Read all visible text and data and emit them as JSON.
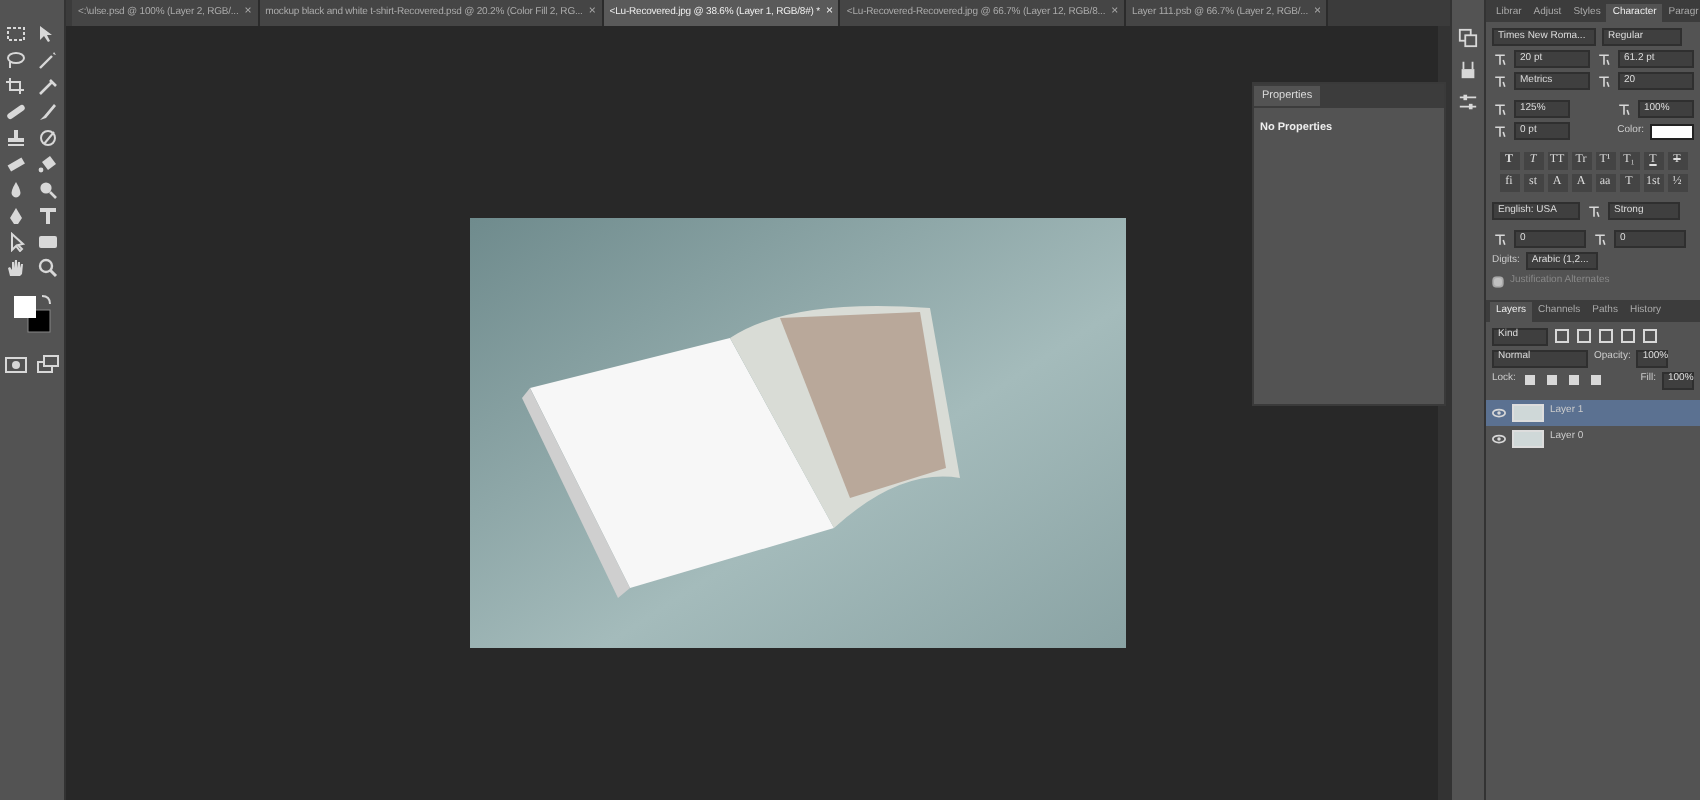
{
  "tabs": [
    {
      "label": "<:\\ulse.psd @ 100% (Layer 2, RGB/...",
      "close": "×",
      "selected": false
    },
    {
      "label": "mockup black and white t-shirt-Recovered.psd @ 20.2% (Color Fill 2, RG...",
      "close": "×",
      "selected": false
    },
    {
      "label": "<Lu-Recovered.jpg @ 38.6% (Layer 1, RGB/8#) *",
      "close": "×",
      "selected": true
    },
    {
      "label": "<Lu-Recovered-Recovered.jpg @ 66.7% (Layer 12, RGB/8...",
      "close": "×",
      "selected": false
    },
    {
      "label": "Layer 111.psb @ 66.7% (Layer 2, RGB/...",
      "close": "×",
      "selected": false
    }
  ],
  "properties_panel": {
    "title": "Properties",
    "message": "No Properties"
  },
  "character_panel": {
    "tabs": [
      {
        "label": "Librar",
        "selected": false
      },
      {
        "label": "Adjust",
        "selected": false
      },
      {
        "label": "Styles",
        "selected": false
      },
      {
        "label": "Character",
        "selected": true
      },
      {
        "label": "Paragr",
        "selected": false
      }
    ],
    "font_family": "Times New Roma...",
    "font_style": "Regular",
    "size": "20 pt",
    "leading": "61.2 pt",
    "kerning": "Metrics",
    "tracking": "20",
    "vertical_scale": "125%",
    "horizontal_scale": "100%",
    "baseline_shift": "0 pt",
    "color_label": "Color:",
    "style_buttons": [
      {
        "label": "T",
        "kind": "bold"
      },
      {
        "label": "T",
        "kind": "italic"
      },
      {
        "label": "TT",
        "kind": "plain"
      },
      {
        "label": "Tr",
        "kind": "plain"
      },
      {
        "label": "T¹",
        "kind": "plain"
      },
      {
        "label": "T₁",
        "kind": "plain"
      },
      {
        "label": "T",
        "kind": "underline"
      },
      {
        "label": "T",
        "kind": "strike"
      }
    ],
    "opentype_buttons": [
      "fi",
      "st",
      "A",
      "A",
      "aa",
      "T",
      "1st",
      "½"
    ],
    "language": "English: USA",
    "antialias": "Strong",
    "tsume": "0",
    "spacing": "0",
    "digits_label": "Digits:",
    "digits": "Arabic (1,2...",
    "justification_alternates": {
      "label": "Justification Alternates",
      "checked": false,
      "disabled": true
    }
  },
  "layers_panel": {
    "tabs": [
      {
        "label": "Layers",
        "selected": true
      },
      {
        "label": "Channels",
        "selected": false
      },
      {
        "label": "Paths",
        "selected": false
      },
      {
        "label": "History",
        "selected": false
      }
    ],
    "filter": "Kind",
    "blend_mode": "Normal",
    "opacity_label": "Opacity:",
    "opacity": "100%",
    "lock_label": "Lock:",
    "fill_label": "Fill:",
    "fill": "100%",
    "layers": [
      {
        "name": "Layer 1",
        "visible": true,
        "selected": true
      },
      {
        "name": "Layer 0",
        "visible": true,
        "selected": false
      }
    ]
  }
}
